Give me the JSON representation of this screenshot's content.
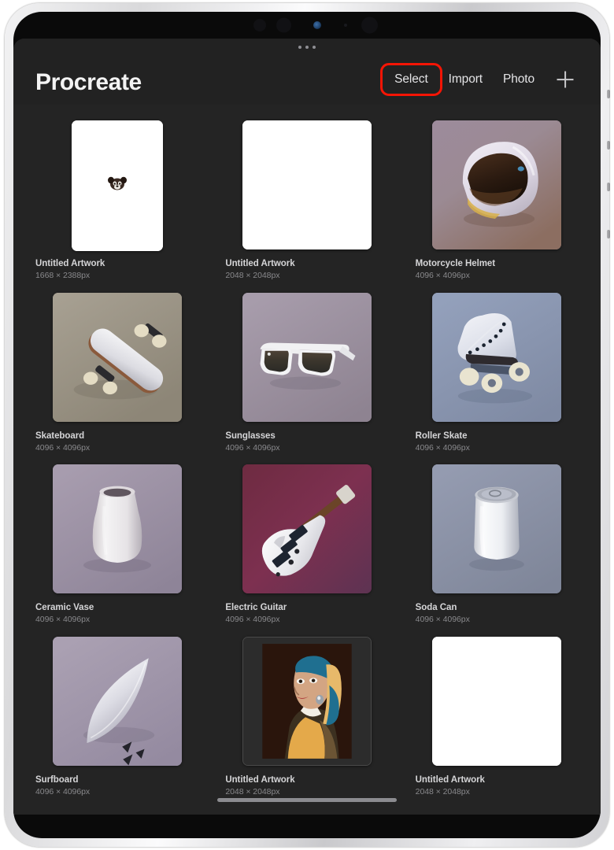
{
  "app": {
    "title": "Procreate",
    "accent_highlight_color": "#f51505",
    "background_color": "#242424"
  },
  "toolbar": {
    "select_label": "Select",
    "import_label": "Import",
    "photo_label": "Photo",
    "add_icon": "plus-icon"
  },
  "gallery": {
    "artworks": [
      {
        "title": "Untitled Artwork",
        "dimensions": "1668 × 2388px",
        "thumb_type": "canvas-blank-portrait",
        "bg": "#ffffff"
      },
      {
        "title": "Untitled Artwork",
        "dimensions": "2048 × 2048px",
        "thumb_type": "canvas-blank-square",
        "bg": "#ffffff"
      },
      {
        "title": "Motorcycle Helmet",
        "dimensions": "4096 × 4096px",
        "thumb_type": "helmet",
        "bg": "#9a8897"
      },
      {
        "title": "Skateboard",
        "dimensions": "4096 × 4096px",
        "thumb_type": "skateboard",
        "bg": "#9f998b"
      },
      {
        "title": "Sunglasses",
        "dimensions": "4096 × 4096px",
        "thumb_type": "sunglasses",
        "bg": "#9e93a0"
      },
      {
        "title": "Roller Skate",
        "dimensions": "4096 × 4096px",
        "thumb_type": "roller-skate",
        "bg": "#8b95ad"
      },
      {
        "title": "Ceramic Vase",
        "dimensions": "4096 × 4096px",
        "thumb_type": "vase",
        "bg": "#9d93a5"
      },
      {
        "title": "Electric Guitar",
        "dimensions": "4096 × 4096px",
        "thumb_type": "guitar",
        "bg": "#7a2f4c"
      },
      {
        "title": "Soda Can",
        "dimensions": "4096 × 4096px",
        "thumb_type": "soda-can",
        "bg": "#8c93a8"
      },
      {
        "title": "Surfboard",
        "dimensions": "4096 × 4096px",
        "thumb_type": "surfboard",
        "bg": "#a095a8"
      },
      {
        "title": "Untitled Artwork",
        "dimensions": "2048 × 2048px",
        "thumb_type": "pearl-earring",
        "bg": "#2c2c2c"
      },
      {
        "title": "Untitled Artwork",
        "dimensions": "2048 × 2048px",
        "thumb_type": "canvas-blank-square",
        "bg": "#ffffff"
      }
    ]
  },
  "device": {
    "sensors": [
      "speaker-grille-icon",
      "speaker-grille-icon",
      "front-camera-icon",
      "microphone-icon",
      "speaker-grille-icon"
    ],
    "multitask_handle": "multitask-handle-icon",
    "home_indicator": "home-indicator"
  }
}
